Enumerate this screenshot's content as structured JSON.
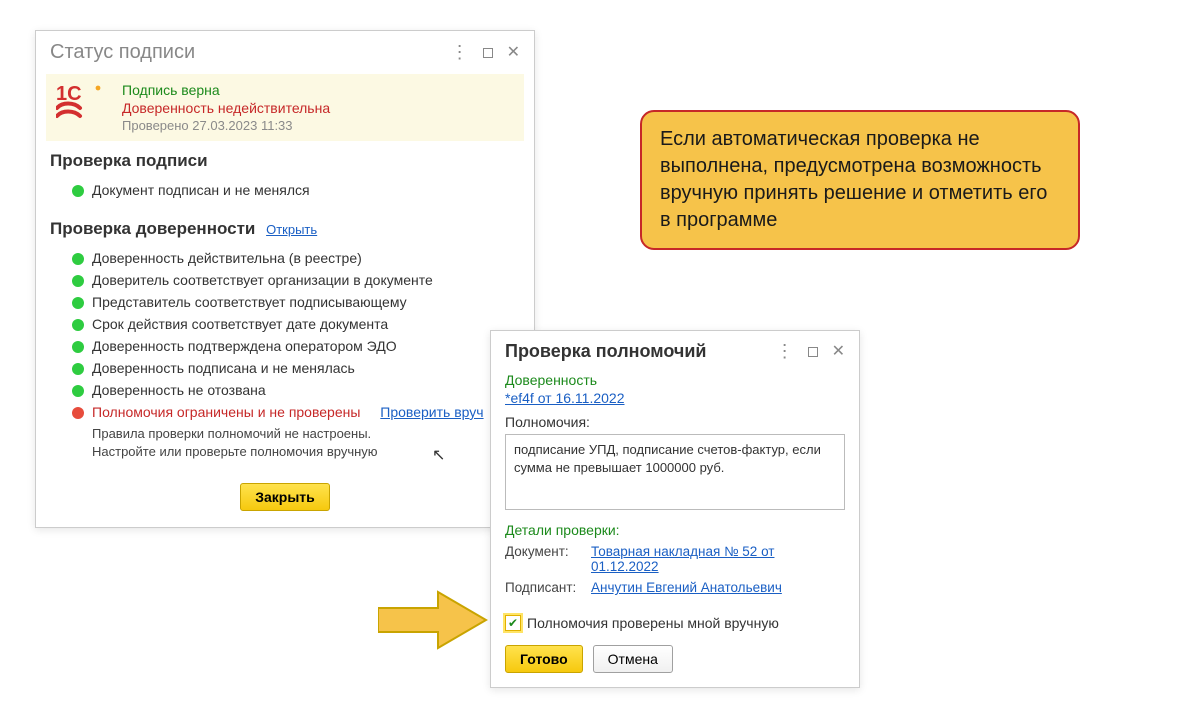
{
  "dlg1": {
    "title": "Статус подписи",
    "banner": {
      "line1": "Подпись верна",
      "line2": "Доверенность недействительна",
      "line3": "Проверено 27.03.2023 11:33"
    },
    "section_sig": {
      "heading": "Проверка подписи",
      "items": [
        {
          "status": "green",
          "text": "Документ подписан и не менялся"
        }
      ]
    },
    "section_poa": {
      "heading": "Проверка доверенности",
      "open_link": "Открыть",
      "items": [
        {
          "status": "green",
          "text": "Доверенность действительна (в реестре)"
        },
        {
          "status": "green",
          "text": "Доверитель соответствует организации в документе"
        },
        {
          "status": "green",
          "text": "Представитель соответствует подписывающему"
        },
        {
          "status": "green",
          "text": "Срок действия соответствует дате документа"
        },
        {
          "status": "green",
          "text": "Доверенность подтверждена оператором ЭДО"
        },
        {
          "status": "green",
          "text": "Доверенность подписана и не менялась"
        },
        {
          "status": "green",
          "text": "Доверенность не отозвана"
        },
        {
          "status": "red",
          "text": "Полномочия ограничены и не проверены",
          "link": "Проверить вруч"
        }
      ],
      "subline1": "Правила проверки полномочий не настроены.",
      "subline2": "Настройте или проверьте полномочия вручную"
    },
    "close_btn": "Закрыть"
  },
  "dlg2": {
    "title": "Проверка полномочий",
    "poa_label": "Доверенность",
    "poa_link": "*ef4f от 16.11.2022",
    "auth_label": "Полномочия:",
    "auth_text": "подписание УПД, подписание счетов-фактур, если сумма не превышает 1000000 руб.",
    "details_label": "Детали проверки:",
    "doc_key": "Документ:",
    "doc_link": "Товарная накладная № 52 от 01.12.2022",
    "signer_key": "Подписант:",
    "signer_link": "Анчутин Евгений Анатольевич",
    "check_label": "Полномочия проверены мной вручную",
    "ok_btn": "Готово",
    "cancel_btn": "Отмена"
  },
  "callout": {
    "text": "Если автоматическая проверка не выполнена, предусмотрена возможность вручную принять решение и отметить его в программе"
  }
}
